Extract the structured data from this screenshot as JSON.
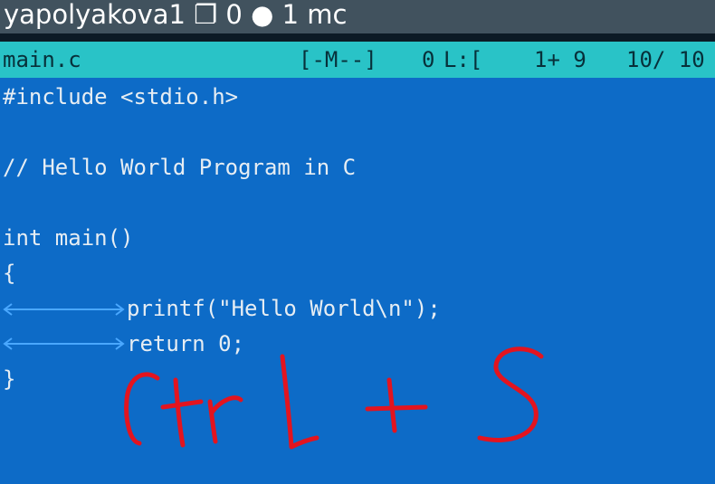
{
  "titlebar": {
    "text": "yapolyakova1 ❐ 0 ● 1 mc"
  },
  "statusbar": {
    "filename": "main.c",
    "mode": "[-M--]",
    "col": "0",
    "line_label": "L:[",
    "pos": "1+ 9",
    "total": "10/ 10"
  },
  "editor": {
    "lines": [
      "#include <stdio.h>",
      "",
      "// Hello World Program in C",
      "",
      "int main()",
      "{",
      "printf(\"Hello World\\n\");",
      "return 0;",
      "}"
    ]
  },
  "annotation": {
    "text": "Ctrl + S",
    "color": "#e3141f"
  },
  "colors": {
    "editor_bg": "#0d6bc7",
    "statusbar_bg": "#29c3c7",
    "tab_marker": "#4aa8ff"
  }
}
